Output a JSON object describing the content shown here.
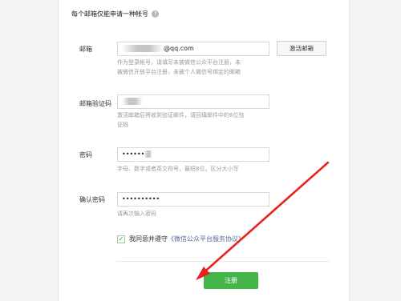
{
  "form": {
    "notice": "每个邮箱仅能申请一种帐号",
    "email": {
      "label": "邮箱",
      "value_suffix": "@qq.com",
      "hint_lines": [
        "作为登录帐号，请填写未被微信公众平台注册，未",
        "被微信开放平台注册，未被个人微信号绑定的邮箱"
      ],
      "activate_label": "激活邮箱"
    },
    "code": {
      "label": "邮箱验证码",
      "hint_lines": [
        "激活邮箱后将收到验证邮件，请回填邮件中的6位验",
        "证码"
      ]
    },
    "password": {
      "label": "密码",
      "value": "••••••",
      "hint": "字母、数字或者英文符号，最短8位，区分大小写"
    },
    "confirm": {
      "label": "确认密码",
      "value": "••••••••••",
      "hint": "请再次输入密码"
    },
    "agreement": {
      "checked": true,
      "text": "我同意并遵守",
      "link": "《微信公众平台服务协议》"
    },
    "submit_label": "注册"
  },
  "colors": {
    "primary_green": "#44b549",
    "annotation_red": "#e8231a",
    "link_blue": "#576b95"
  }
}
